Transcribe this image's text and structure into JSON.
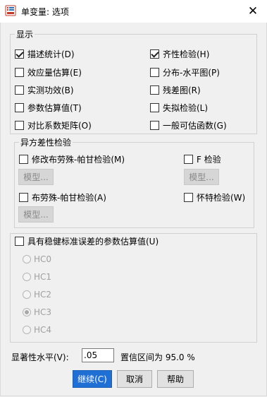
{
  "window": {
    "title": "单变量: 选项",
    "close_glyph": "✕"
  },
  "display_group": {
    "legend": "显示",
    "left": [
      {
        "label": "描述统计(D)",
        "checked": true
      },
      {
        "label": "效应量估算(E)",
        "checked": false
      },
      {
        "label": "实测功效(B)",
        "checked": false
      },
      {
        "label": "参数估算值(T)",
        "checked": false
      },
      {
        "label": "对比系数矩阵(O)",
        "checked": false
      }
    ],
    "right": [
      {
        "label": "齐性检验(H)",
        "checked": true
      },
      {
        "label": "分布-水平图(P)",
        "checked": false
      },
      {
        "label": "残差图(R)",
        "checked": false
      },
      {
        "label": "失拟检验(L)",
        "checked": false
      },
      {
        "label": "一般可估函数(G)",
        "checked": false
      }
    ]
  },
  "hetero_group": {
    "legend": "异方差性检验",
    "modified_bp": "修改布劳殊-帕甘检验(M)",
    "f_test": "F 检验",
    "model1": "模型...",
    "model2": "模型...",
    "bp": "布劳殊-帕甘检验(A)",
    "white": "怀特检验(W)",
    "model3": "模型..."
  },
  "robust": {
    "label": "具有稳健标准误差的参数估算值(U)",
    "options": [
      "HC0",
      "HC1",
      "HC2",
      "HC3",
      "HC4"
    ],
    "selected": "HC3"
  },
  "significance": {
    "label": "显著性水平(V):",
    "value": ".05",
    "ci_text": "置信区间为 95.0 %"
  },
  "buttons": {
    "continue": "继续(C)",
    "cancel": "取消",
    "help": "帮助"
  }
}
